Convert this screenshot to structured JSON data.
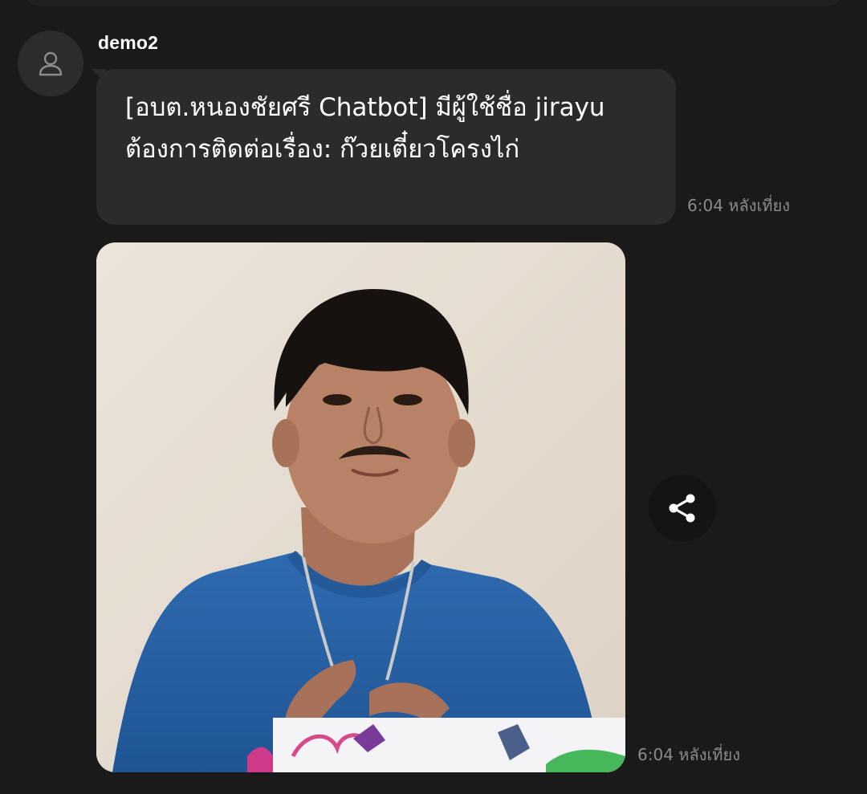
{
  "message": {
    "sender": "demo2",
    "text": "[อบต.หนองชัยศรี Chatbot] มีผู้ใช้ชื่อ jirayu ต้องการติดต่อเรื่อง: ก๊วยเตี๋ยวโครงไก่",
    "timestamp": "6:04 หลังเที่ยง"
  },
  "image_message": {
    "timestamp": "6:04 หลังเที่ยง"
  },
  "icons": {
    "avatar": "person-outline-icon",
    "share": "share-icon"
  },
  "colors": {
    "background": "#1a1a1a",
    "bubble": "#2b2b2b",
    "text": "#ffffff",
    "timestamp": "#8a8a8a",
    "shirt": "#2a63a6",
    "wall": "#e9dfd4"
  }
}
